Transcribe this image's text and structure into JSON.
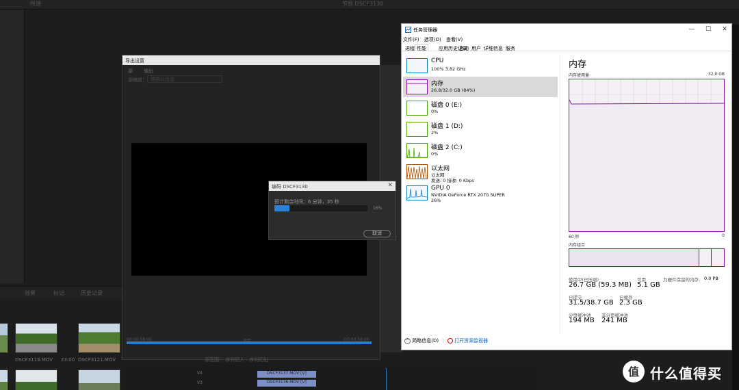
{
  "premiere": {
    "top_labels": [
      "",
      "所源",
      "节目 DSCF3130"
    ],
    "bottom_tabs": [
      "效果",
      "标记",
      "历史记录"
    ],
    "thumbs": [
      {
        "label": "DSCF3119.MOV",
        "duration": "23:00"
      },
      {
        "label": "DSCF3121.MOV",
        "duration": ""
      }
    ],
    "timeline_tracks": [
      "V4",
      "V3"
    ],
    "clips": [
      "DSCF3137.MOV [V]",
      "DSCF3136.MOV [V]"
    ]
  },
  "export_dialog": {
    "title": "导出设置",
    "tabs": [
      "源",
      "输出"
    ],
    "source_label": "源缩放：",
    "source_value": "缩放以适合",
    "time_left": "00:00:58:00",
    "time_right": "00:00:58:00",
    "fit_label": "适合",
    "bottom_text": "源范围：  序列切入 - 序列切出"
  },
  "encoding_dialog": {
    "title": "编码 DSCF3130",
    "remaining": "预计剩余时间：6 分钟，35 秒",
    "progress_fraction": 0.16,
    "percent_text": "16%",
    "cancel": "取消"
  },
  "task_manager": {
    "title": "任务管理器",
    "menu": [
      "文件(F)",
      "选项(O)",
      "查看(V)"
    ],
    "tabs": [
      "进程",
      "性能",
      "应用历史记录",
      "启动",
      "用户",
      "详细信息",
      "服务"
    ],
    "active_tab": 1,
    "items": [
      {
        "name": "CPU",
        "sub1": "100%  3.82 GHz",
        "sub2": "",
        "sub3": "",
        "color": "#117dbb"
      },
      {
        "name": "内存",
        "sub1": "26.8/32.0 GB (84%)",
        "sub2": "",
        "sub3": "",
        "color": "#8b14a8"
      },
      {
        "name": "磁盘 0 (E:)",
        "sub1": "0%",
        "sub2": "",
        "sub3": "",
        "color": "#4da60c"
      },
      {
        "name": "磁盘 1 (D:)",
        "sub1": "2%",
        "sub2": "",
        "sub3": "",
        "color": "#4da60c"
      },
      {
        "name": "磁盘 2 (C:)",
        "sub1": "0%",
        "sub2": "",
        "sub3": "",
        "color": "#4da60c"
      },
      {
        "name": "以太网",
        "sub1": "以太网",
        "sub2": "发送: 0  接收: 0 Kbps",
        "sub3": "",
        "color": "#a74f01"
      },
      {
        "name": "GPU 0",
        "sub1": "NVIDIA GeForce RTX 2070 SUPER",
        "sub2": "26%",
        "sub3": "",
        "color": "#117dbb"
      }
    ],
    "detail": {
      "title": "内存",
      "usage_label": "内存使用量",
      "max_label": "32.0 GB",
      "axis_left": "60 秒",
      "axis_right": "0",
      "comp_label": "内存组合",
      "in_use_label": "使用中(已压缩)",
      "in_use_value": "26.7 GB (59.3 MB)",
      "available_label": "可用",
      "available_value": "5.1 GB",
      "reserved_label": "为硬件保留的内存:",
      "reserved_value": "0.0 PB",
      "committed_label": "已提交",
      "committed_value": "31.5/38.7 GB",
      "cached_label": "已缓存",
      "cached_value": "2.3 GB",
      "paged_label": "分页缓冲池",
      "paged_value": "194 MB",
      "nonpaged_label": "非分页缓冲池",
      "nonpaged_value": "241 MB",
      "usage_fraction": 0.84
    },
    "footer_brief": "简略信息(D)",
    "footer_link": "打开资源监视器"
  },
  "watermark": {
    "text": "什么值得买"
  }
}
